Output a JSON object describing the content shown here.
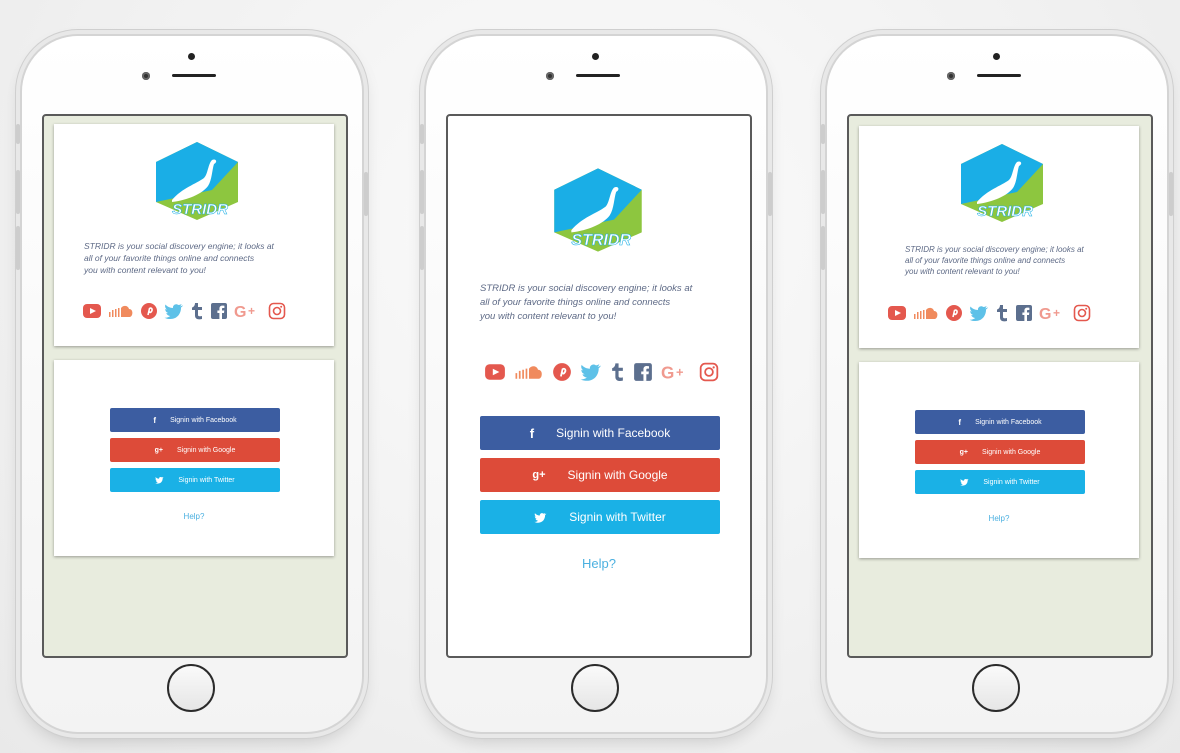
{
  "app": {
    "brand": "STRIDR",
    "tagline_lines": [
      "STRIDR is your social discovery engine; it looks at",
      "all of your favorite things online and connects",
      "you with content relevant to you!"
    ],
    "buttons": {
      "facebook": "Signin with Facebook",
      "google": "Signin with Google",
      "twitter": "Signin with Twitter"
    },
    "help": "Help?",
    "social_icons": [
      "youtube-icon",
      "soundcloud-icon",
      "pinterest-icon",
      "twitter-icon",
      "tumblr-icon",
      "facebook-icon",
      "google-plus-icon",
      "instagram-icon"
    ],
    "glyphs": {
      "fb": "f",
      "g": "g+",
      "tw": "✓"
    },
    "colors": {
      "facebook": "#3c5da1",
      "google": "#dd4b39",
      "twitter": "#1ab1e6",
      "help": "#4bb0e0",
      "logo_blue": "#1aaee6",
      "logo_green": "#8dc63f",
      "screen_gray": "#e8ecde"
    }
  }
}
